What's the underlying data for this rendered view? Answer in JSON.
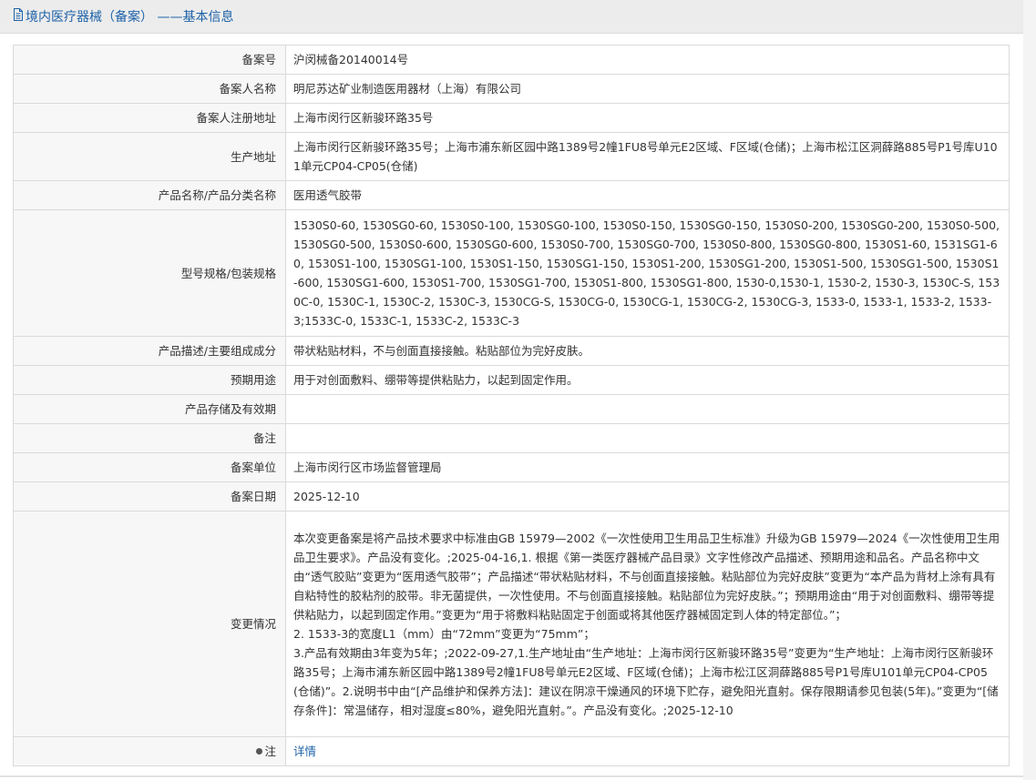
{
  "header": {
    "icon": "document-icon",
    "title": "境内医疗器械（备案） ——基本信息"
  },
  "rows": [
    {
      "label": "备案号",
      "value": "沪闵械备20140014号"
    },
    {
      "label": "备案人名称",
      "value": "明尼苏达矿业制造医用器材（上海）有限公司"
    },
    {
      "label": "备案人注册地址",
      "value": "上海市闵行区新骏环路35号"
    },
    {
      "label": "生产地址",
      "value": "上海市闵行区新骏环路35号；上海市浦东新区园中路1389号2幢1FU8号单元E2区域、F区域(仓储)；上海市松江区洞薛路885号P1号库U101单元CP04-CP05(仓储)"
    },
    {
      "label": "产品名称/产品分类名称",
      "value": "医用透气胶带"
    },
    {
      "label": "型号规格/包装规格",
      "value": "1530S0-60, 1530SG0-60, 1530S0-100, 1530SG0-100, 1530S0-150, 1530SG0-150, 1530S0-200, 1530SG0-200, 1530S0-500, 1530SG0-500, 1530S0-600, 1530SG0-600, 1530S0-700, 1530SG0-700, 1530S0-800, 1530SG0-800, 1530S1-60, 1531SG1-60, 1530S1-100, 1530SG1-100, 1530S1-150, 1530SG1-150, 1530S1-200, 1530SG1-200, 1530S1-500, 1530SG1-500, 1530S1-600, 1530SG1-600, 1530S1-700, 1530SG1-700, 1530S1-800, 1530SG1-800, 1530-0,1530-1, 1530-2, 1530-3, 1530C-S, 1530C-0, 1530C-1, 1530C-2, 1530C-3, 1530CG-S, 1530CG-0, 1530CG-1, 1530CG-2, 1530CG-3, 1533-0, 1533-1, 1533-2, 1533-3;1533C-0, 1533C-1, 1533C-2, 1533C-3"
    },
    {
      "label": "产品描述/主要组成成分",
      "value": "带状粘贴材料，不与创面直接接触。粘贴部位为完好皮肤。"
    },
    {
      "label": "预期用途",
      "value": "用于对创面敷料、绷带等提供粘贴力，以起到固定作用。"
    },
    {
      "label": "产品存储及有效期",
      "value": ""
    },
    {
      "label": "备注",
      "value": ""
    },
    {
      "label": "备案单位",
      "value": "上海市闵行区市场监督管理局"
    },
    {
      "label": "备案日期",
      "value": "2025-12-10"
    },
    {
      "label": "变更情况",
      "lines": [
        "本次变更备案是将产品技术要求中标准由GB 15979—2002《一次性使用卫生用品卫生标准》升级为GB 15979—2024《一次性使用卫生用品卫生要求》。产品没有变化。;2025-04-16,1. 根据《第一类医疗器械产品目录》文字性修改产品描述、预期用途和品名。产品名称中文由“透气胶贴”变更为“医用透气胶带”；产品描述“带状粘贴材料，不与创面直接接触。粘贴部位为完好皮肤”变更为“本产品为背材上涂有具有自粘特性的胶粘剂的胶带。非无菌提供，一次性使用。不与创面直接接触。粘贴部位为完好皮肤。”；预期用途由“用于对创面敷料、绷带等提供粘贴力，以起到固定作用。”变更为“用于将敷料粘贴固定于创面或将其他医疗器械固定到人体的特定部位。”；",
        "2. 1533-3的宽度L1（mm）由“72mm”变更为“75mm”；",
        "3.产品有效期由3年变为5年；;2022-09-27,1.生产地址由“生产地址：上海市闵行区新骏环路35号”变更为“生产地址：上海市闵行区新骏环路35号；上海市浦东新区园中路1389号2幢1FU8号单元E2区域、F区域(仓储)；上海市松江区洞薛路885号P1号库U101单元CP04-CP05(仓储)”。2.说明书中由“[产品维护和保养方法]：建议在阴凉干燥通风的环境下贮存，避免阳光直射。保存限期请参见包装(5年)。”变更为“[储存条件]：常温储存，相对湿度≤80%，避免阳光直射。”。产品没有变化。;2025-12-10"
      ]
    },
    {
      "label": "注",
      "label_icon": "pin-icon",
      "link_text": "详情"
    }
  ]
}
